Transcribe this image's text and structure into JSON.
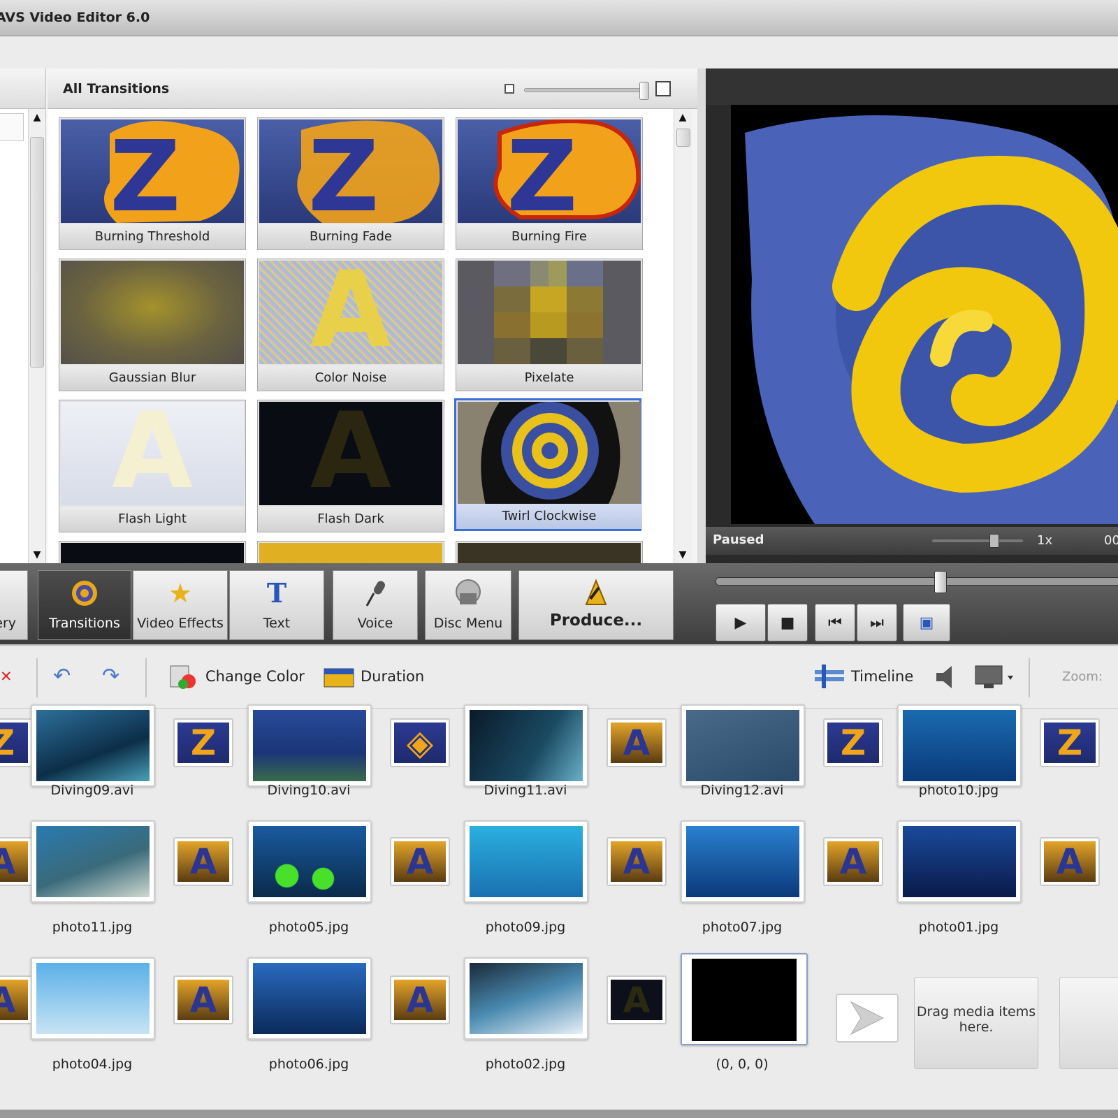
{
  "window": {
    "title": "AVS Video Editor 6.0"
  },
  "transitions_panel": {
    "header": "All Transitions",
    "items": [
      {
        "label": "Burning Threshold",
        "selected": false
      },
      {
        "label": "Burning Fade",
        "selected": false
      },
      {
        "label": "Burning Fire",
        "selected": false
      },
      {
        "label": "Gaussian Blur",
        "selected": false
      },
      {
        "label": "Color Noise",
        "selected": false
      },
      {
        "label": "Pixelate",
        "selected": false
      },
      {
        "label": "Flash Light",
        "selected": false
      },
      {
        "label": "Flash Dark",
        "selected": false
      },
      {
        "label": "Twirl Clockwise",
        "selected": true
      }
    ]
  },
  "preview": {
    "status": "Paused",
    "speed": "1x",
    "timecode": "00"
  },
  "tabs": [
    {
      "label": "ery",
      "icon": "library-icon"
    },
    {
      "label": "Transitions",
      "icon": "transitions-icon",
      "active": true
    },
    {
      "label": "Video Effects",
      "icon": "video-effects-icon"
    },
    {
      "label": "Text",
      "icon": "text-icon"
    },
    {
      "label": "Voice",
      "icon": "microphone-icon"
    },
    {
      "label": "Disc Menu",
      "icon": "disc-menu-icon"
    },
    {
      "label": "Produce...",
      "icon": "produce-icon"
    }
  ],
  "player_buttons": [
    "play-icon",
    "stop-icon",
    "prev-frame-icon",
    "next-frame-icon",
    "fullscreen-icon"
  ],
  "storyboard_toolbar": {
    "change_color": "Change Color",
    "duration": "Duration",
    "timeline": "Timeline",
    "zoom": "Zoom:"
  },
  "storyboard": {
    "clips": [
      "Diving09.avi",
      "Diving10.avi",
      "Diving11.avi",
      "Diving12.avi",
      "photo10.jpg",
      "photo11.jpg",
      "photo05.jpg",
      "photo09.jpg",
      "photo07.jpg",
      "photo01.jpg",
      "photo04.jpg",
      "photo06.jpg",
      "photo02.jpg",
      "(0, 0, 0)"
    ],
    "drop_hint": "Drag media items here."
  },
  "colors": {
    "selection": "#3b6fd6",
    "accent_yellow": "#f2c416",
    "accent_blue": "#2e3796"
  }
}
